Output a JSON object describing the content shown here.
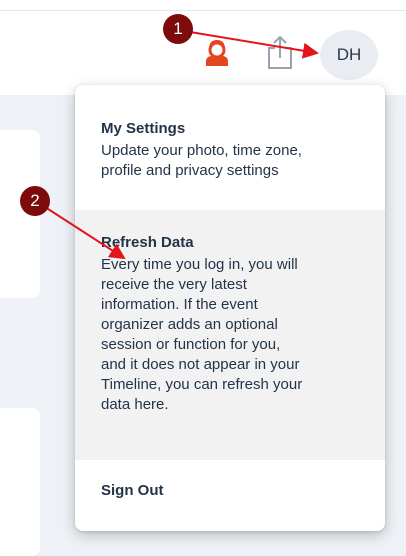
{
  "header": {
    "avatar_initials": "DH",
    "icons": [
      "presenter-icon",
      "share-icon"
    ]
  },
  "menu": {
    "settings": {
      "title": "My Settings",
      "desc": "Update your photo, time zone,\nprofile and privacy settings"
    },
    "refresh": {
      "title": "Refresh Data",
      "desc": "Every time you log in, you will\nreceive the very latest\ninformation. If the event\norganizer adds an optional\nsession or function for you,\nand it does not appear in your\nTimeline, you can refresh your\ndata here."
    },
    "signout": {
      "title": "Sign Out"
    }
  },
  "annotations": {
    "step1": "1",
    "step2": "2"
  },
  "colors": {
    "annotation": "#7d0b0b",
    "arrow": "#e3141b",
    "presenter_icon": "#e3461f",
    "text": "#233449"
  }
}
